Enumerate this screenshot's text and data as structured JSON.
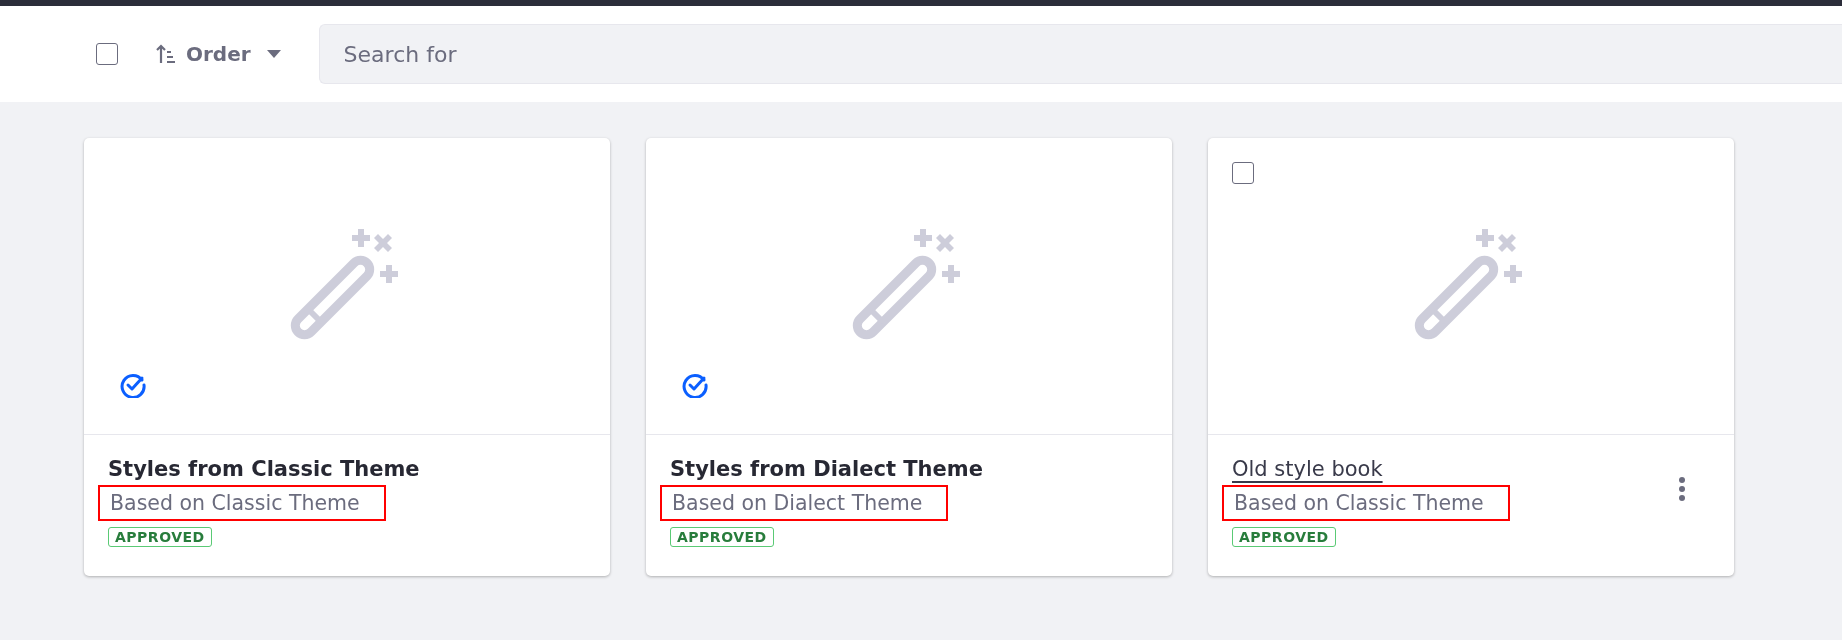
{
  "toolbar": {
    "select_all": {
      "checked": false
    },
    "order": {
      "label": "Order"
    },
    "search": {
      "placeholder": "Search for"
    }
  },
  "cards": [
    {
      "kind": "default",
      "title": "Styles from Classic Theme",
      "subtitle": "Based on Classic Theme",
      "status": "APPROVED",
      "highlighted": true
    },
    {
      "kind": "default",
      "title": "Styles from Dialect Theme",
      "subtitle": "Based on Dialect Theme",
      "status": "APPROVED",
      "highlighted": true
    },
    {
      "kind": "selectable",
      "title": "Old style book",
      "subtitle": "Based on Classic Theme",
      "status": "APPROVED",
      "highlighted": true,
      "checkbox": {
        "checked": false
      }
    }
  ]
}
